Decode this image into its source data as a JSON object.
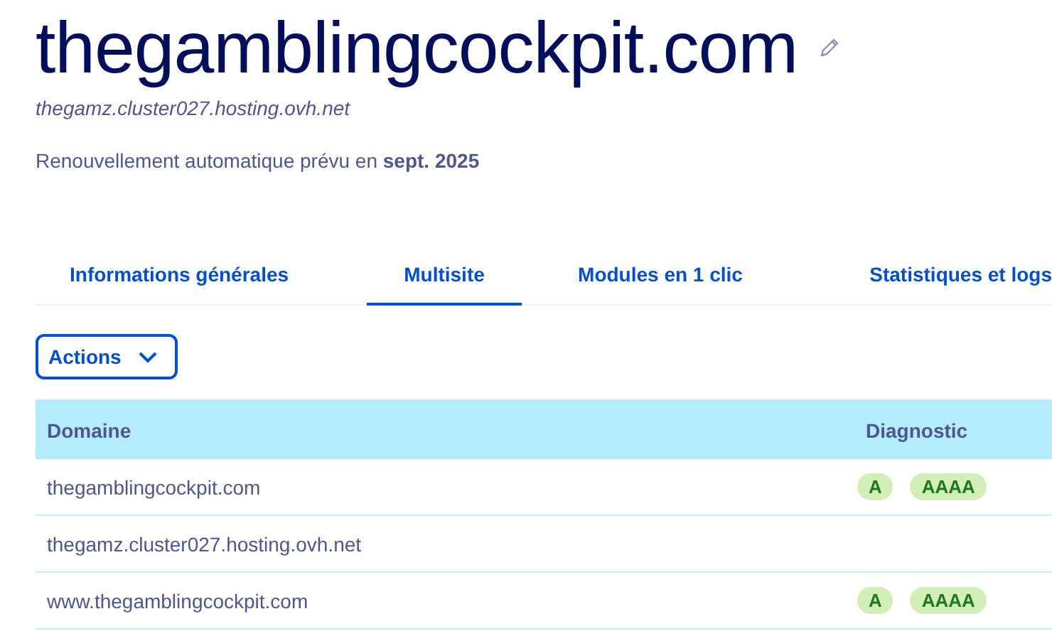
{
  "header": {
    "title": "thegamblingcockpit.com",
    "subtitle": "thegamz.cluster027.hosting.ovh.net",
    "renewal": "Renouvellement automatique prévu en **sept. 2025**"
  },
  "tabs": [
    {
      "label": "Informations générales",
      "selected": false
    },
    {
      "label": "Multisite",
      "selected": true
    },
    {
      "label": "Modules en 1 clic",
      "selected": false
    },
    {
      "label": "Statistiques et logs",
      "selected": false
    }
  ],
  "actions_button": "Actions",
  "table": {
    "columns": [
      "Domaine",
      "Diagnostic"
    ],
    "rows": [
      {
        "domain": "thegamblingcockpit.com",
        "diagnostic": [
          "A",
          "AAAA"
        ]
      },
      {
        "domain": "thegamz.cluster027.hosting.ovh.net"
      },
      {
        "domain": "www.thegamblingcockpit.com",
        "diagnostic": [
          "A",
          "AAAA"
        ]
      }
    ]
  }
}
